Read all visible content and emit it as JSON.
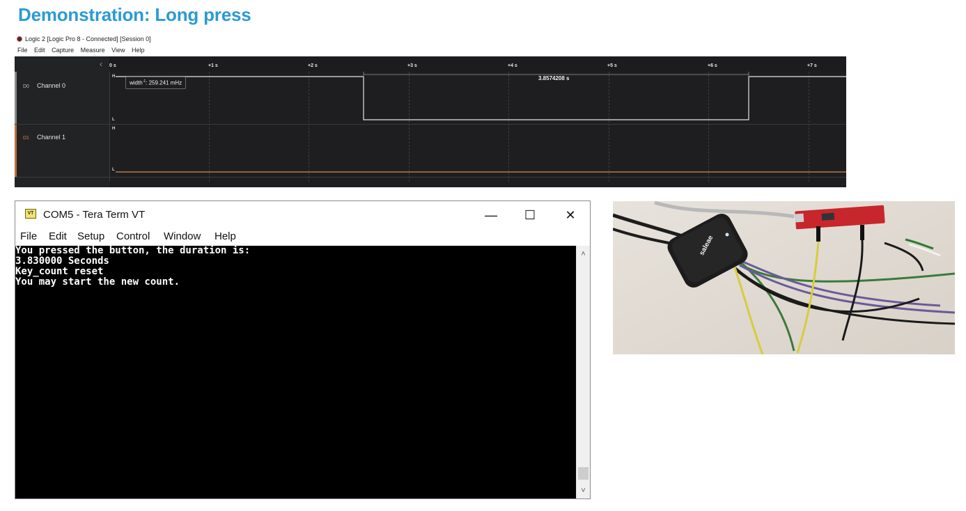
{
  "slide": {
    "title": "Demonstration: Long press"
  },
  "logic": {
    "window_title": "Logic 2 [Logic Pro 8 - Connected] [Session 0]",
    "menu": [
      "File",
      "Edit",
      "Capture",
      "Measure",
      "View",
      "Help"
    ],
    "ruler": [
      "0 s",
      "+1 s",
      "+2 s",
      "+3 s",
      "+4 s",
      "+5 s",
      "+6 s",
      "+7 s"
    ],
    "channels": [
      {
        "id": "D0",
        "name": "Channel 0",
        "id_color": "#bbbbbb"
      },
      {
        "id": "D1",
        "name": "Channel 1",
        "id_color": "#e0804a"
      }
    ],
    "level_high": "H",
    "level_low": "L",
    "tooltip": {
      "prefix": "width",
      "sup": "-1",
      "suffix": ": 259.241 mHz"
    },
    "duration": "3.8574208 s",
    "colors": {
      "background": "#1e1e20",
      "signal_ch0": "#e6e6e6",
      "signal_ch1": "#d98a4b"
    }
  },
  "teraterm": {
    "title": "COM5 - Tera Term VT",
    "icon_text": "VT",
    "window_controls": {
      "minimize": "—",
      "maximize": "☐",
      "close": "✕"
    },
    "menu": [
      "File",
      "Edit",
      "Setup",
      "Control",
      "Window",
      "Help"
    ],
    "lines": [
      "You pressed the button, the duration is:",
      "3.830000 Seconds",
      "Key_count reset",
      "You may start the new count."
    ],
    "scroll_up": "˄",
    "scroll_down": "˅"
  },
  "photo": {
    "device_brand": "saleae"
  }
}
